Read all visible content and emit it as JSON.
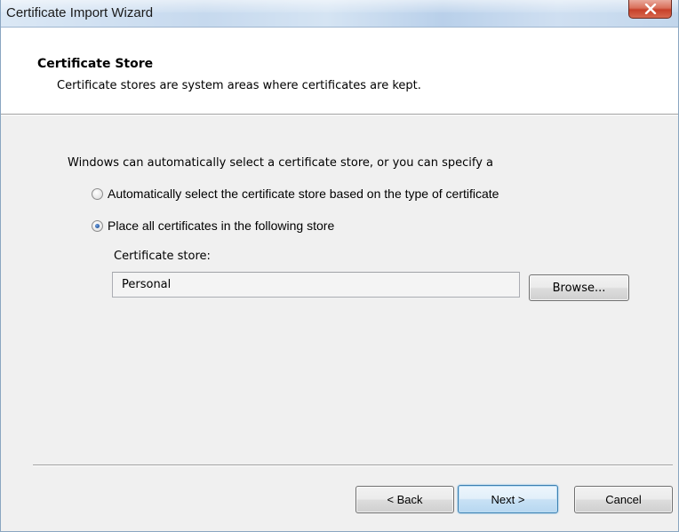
{
  "window": {
    "title": "Certificate Import Wizard",
    "close_glyph": "X"
  },
  "header": {
    "title": "Certificate Store",
    "description": "Certificate stores are system areas where certificates are kept."
  },
  "body": {
    "intro": "Windows can automatically select a certificate store, or you can specify a",
    "options": [
      {
        "label": "Automatically select the certificate store based on the type of certificate",
        "selected": false
      },
      {
        "label": "Place all certificates in the following store",
        "selected": true
      }
    ],
    "store_label": "Certificate store:",
    "store_value": "Personal",
    "browse_label": "Browse..."
  },
  "footer": {
    "back_label": "< Back",
    "next_label": "Next >",
    "cancel_label": "Cancel"
  },
  "colors": {
    "dialog_bg": "#f0f0f0",
    "header_bg": "#ffffff",
    "close_button": "#c7402a",
    "default_button_border": "#3c7fb1"
  },
  "icons": {
    "close": "close-icon",
    "radio_unchecked": "radio-unchecked-icon",
    "radio_checked": "radio-checked-icon"
  }
}
